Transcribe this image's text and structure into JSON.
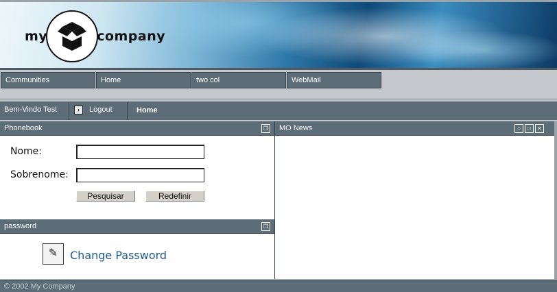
{
  "brand": {
    "word_left": "my",
    "word_right": "company"
  },
  "nav": {
    "items": [
      {
        "label": "Communities"
      },
      {
        "label": "Home"
      },
      {
        "label": "two col"
      },
      {
        "label": "WebMail"
      }
    ]
  },
  "welcome": {
    "user": "Bem-Vindo Test",
    "logout": "Logout",
    "current_page": "Home"
  },
  "phonebook": {
    "title": "Phonebook",
    "nome_label": "Nome:",
    "nome_value": "",
    "sobrenome_label": "Sobrenome:",
    "sobrenome_value": "",
    "search_button": "Pesquisar",
    "reset_button": "Redefinir"
  },
  "password": {
    "title": "password",
    "link": "Change Password"
  },
  "news": {
    "title": "MO News"
  },
  "footer": {
    "copyright": "© 2002 My Company"
  },
  "colors": {
    "bar": "#5c6d78",
    "link": "#1f5a8c",
    "background": "#c4c8cc"
  }
}
